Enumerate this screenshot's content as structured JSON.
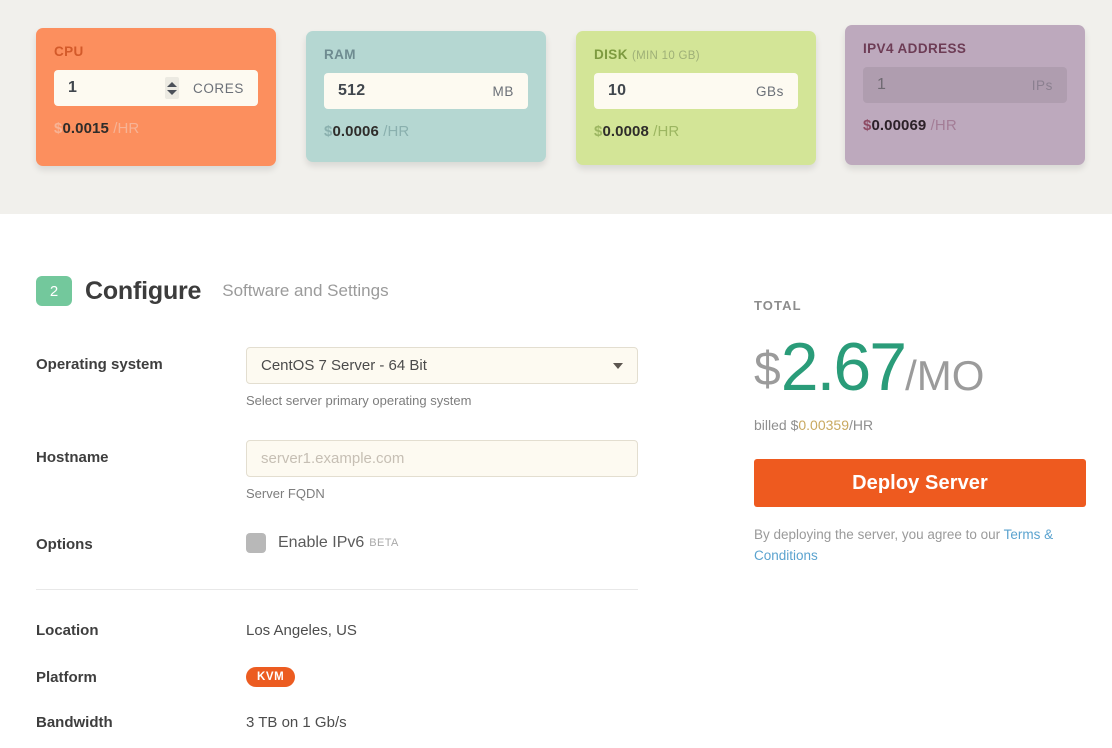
{
  "specs": [
    {
      "key": "cpu",
      "label": "CPU",
      "sub": "",
      "value": "1",
      "unit": "CORES",
      "price_symbol": "$",
      "price_amount": "0.0015",
      "price_period": "/HR",
      "has_stepper": true,
      "disabled": false,
      "card_color": "#fc8f5e"
    },
    {
      "key": "ram",
      "label": "RAM",
      "sub": "",
      "value": "512",
      "unit": "MB",
      "price_symbol": "$",
      "price_amount": "0.0006",
      "price_period": "/HR",
      "has_stepper": false,
      "disabled": false,
      "card_color": "#b5d7d2"
    },
    {
      "key": "disk",
      "label": "DISK",
      "sub": "(MIN 10 GB)",
      "value": "10",
      "unit": "GBs",
      "price_symbol": "$",
      "price_amount": "0.0008",
      "price_period": "/HR",
      "has_stepper": false,
      "disabled": false,
      "card_color": "#d3e597"
    },
    {
      "key": "ipv4",
      "label": "IPV4 ADDRESS",
      "sub": "",
      "value": "1",
      "unit": "IPs",
      "price_symbol": "$",
      "price_amount": "0.00069",
      "price_period": "/HR",
      "has_stepper": false,
      "disabled": true,
      "card_color": "#bda9bd"
    }
  ],
  "step": {
    "number": "2",
    "title": "Configure",
    "subtitle": "Software and Settings",
    "badge_color": "#73c89c"
  },
  "form": {
    "os": {
      "label": "Operating system",
      "value": "CentOS 7 Server - 64 Bit",
      "hint": "Select server primary operating system",
      "caret_icon": "chevron-down-icon"
    },
    "hostname": {
      "label": "Hostname",
      "value": "",
      "placeholder": "server1.example.com",
      "hint": "Server FQDN"
    },
    "options": {
      "label": "Options",
      "checkbox_label": "Enable IPv6",
      "badge": "BETA",
      "checked": false
    }
  },
  "details": [
    {
      "label": "Location",
      "value": "Los Angeles, US",
      "type": "text"
    },
    {
      "label": "Platform",
      "value": "KVM",
      "type": "pill",
      "pill_color": "#ec5c21"
    },
    {
      "label": "Bandwidth",
      "value": "3 TB on 1 Gb/s",
      "type": "text"
    }
  ],
  "total": {
    "label": "TOTAL",
    "currency_symbol": "$",
    "amount": "2.67",
    "period": "/MO",
    "billed_prefix": "billed $",
    "billed_amount": "0.00359",
    "billed_period": "/HR",
    "amount_color": "#2a9c79",
    "deploy_label": "Deploy Server",
    "deploy_color": "#ee5a1f",
    "terms_text": "By deploying the server, you agree to our ",
    "terms_link": "Terms & Conditions",
    "link_color": "#5ba3cf"
  }
}
